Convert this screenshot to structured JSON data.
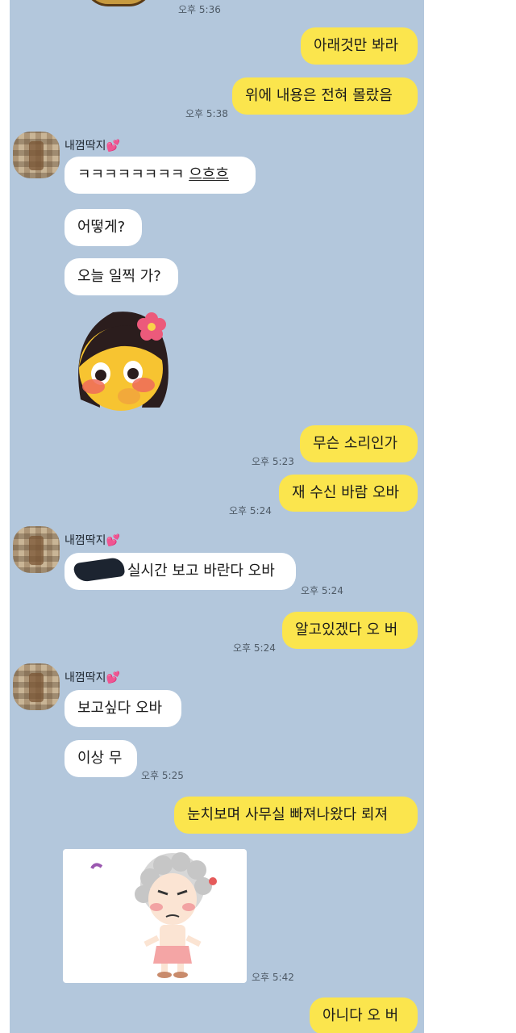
{
  "top_time": "오후 5:36",
  "contact_name": "내껌딱지",
  "messages": {
    "m1": "아래것만 봐라",
    "m2": "위에 내용은 전혀 몰랐음",
    "t2": "오후 5:38",
    "r1a": "ㅋㅋㅋㅋㅋㅋㅋㅋ ",
    "r1b": "으흐흐",
    "r2": "어떻게?",
    "r3": "오늘 일찍 가?",
    "m3": "무슨 소리인가",
    "t3": "오후 5:23",
    "m4": "재 수신 바람 오바",
    "t4": "오후 5:24",
    "r4": "실시간 보고 바란다 오바",
    "tr4": "오후 5:24",
    "m5": "알고있겠다 오 버",
    "t5": "오후 5:24",
    "r5": "보고싶다 오바",
    "r6": "이상 무",
    "tr6": "오후 5:25",
    "m6": "눈치보며 사무실 빠져나왔다 뢰져",
    "tphoto": "오후 5:42",
    "m7": "아니다 오 버"
  },
  "colors": {
    "chat_bg": "#b3c7dc",
    "my_bubble": "#fbe54d",
    "their_bubble": "#ffffff"
  },
  "icons": [
    "heart-icon",
    "blushing-girl-sticker",
    "grandma-sticker"
  ]
}
